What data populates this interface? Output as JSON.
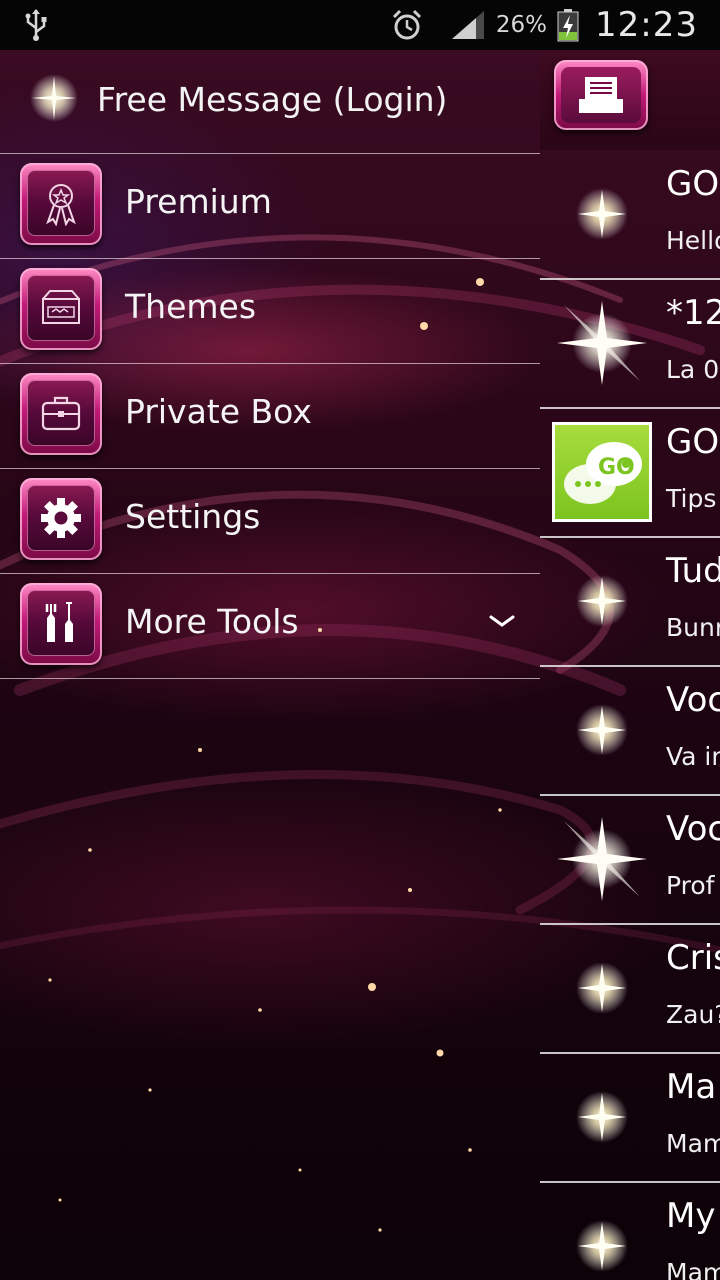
{
  "status_bar": {
    "battery_percent": "26%",
    "time": "12:23",
    "icons": [
      "usb-icon",
      "alarm-icon",
      "signal-icon",
      "battery-charging-icon"
    ]
  },
  "drawer": {
    "header_title": "Free Message (Login)",
    "items": [
      {
        "label": "Premium",
        "icon": "ribbon-award-icon"
      },
      {
        "label": "Themes",
        "icon": "themes-store-icon"
      },
      {
        "label": "Private Box",
        "icon": "briefcase-icon"
      },
      {
        "label": "Settings",
        "icon": "gear-icon"
      },
      {
        "label": "More Tools",
        "icon": "tools-icon",
        "expand_icon": "chevron-down-icon"
      }
    ]
  },
  "conversations": [
    {
      "name": "GO",
      "snippet": "Hello",
      "avatar": "star"
    },
    {
      "name": "*12",
      "snippet": "La 0",
      "avatar": "star-big"
    },
    {
      "name": "GO",
      "snippet": "Tips",
      "avatar": "go-sms-logo"
    },
    {
      "name": "Tud",
      "snippet": "Bunr",
      "avatar": "star"
    },
    {
      "name": "Voc",
      "snippet": "Va ir",
      "avatar": "star"
    },
    {
      "name": "Voc",
      "snippet": "Prof",
      "avatar": "star-big"
    },
    {
      "name": "Cris",
      "snippet": "Zau?",
      "avatar": "star"
    },
    {
      "name": "Ma",
      "snippet": "Mam",
      "avatar": "star"
    },
    {
      "name": "My",
      "snippet": "Mam",
      "avatar": "star"
    }
  ],
  "colors": {
    "accent": "#c21a78",
    "accent_light": "#ff8cc6",
    "background": "#2a0618"
  }
}
